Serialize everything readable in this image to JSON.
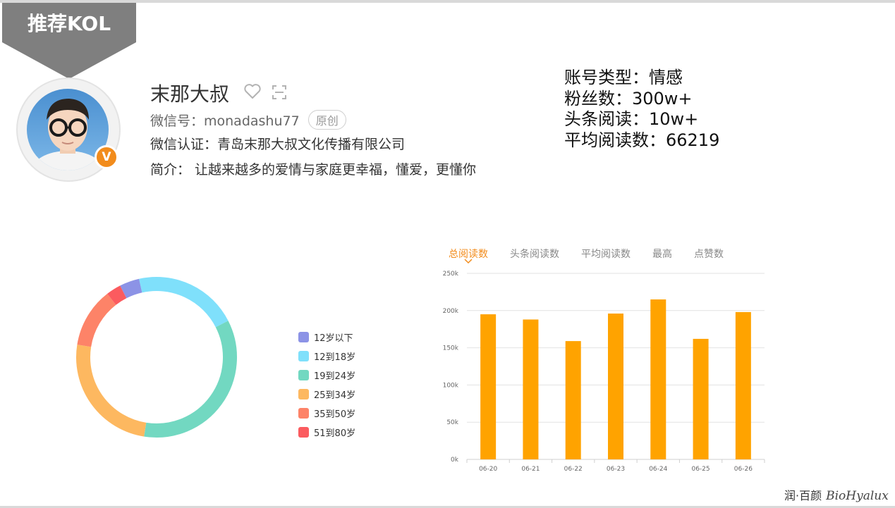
{
  "header": {
    "tag_label": "推荐KOL"
  },
  "profile": {
    "name": "末那大叔",
    "wechat_id": "微信号：monadashu77",
    "original_badge": "原创",
    "certification": "微信认证：青岛末那大叔文化传播有限公司",
    "intro": "简介： 让越来越多的爱情与家庭更幸福，懂爱，更懂你",
    "verified_badge": "V",
    "icons": [
      "heart-icon",
      "scan-icon"
    ]
  },
  "stats": {
    "account_type": "账号类型：情感",
    "followers": "粉丝数：300w+",
    "headline_reads": "头条阅读：10w+",
    "avg_reads": "平均阅读数：66219"
  },
  "age_chart": {
    "legend": [
      {
        "label": "12岁以下",
        "color": "#8c93e6"
      },
      {
        "label": "12到18岁",
        "color": "#7fe0fb"
      },
      {
        "label": "19到24岁",
        "color": "#72d8c1"
      },
      {
        "label": "25到34岁",
        "color": "#fdb860"
      },
      {
        "label": "35到50岁",
        "color": "#fd8368"
      },
      {
        "label": "51到80岁",
        "color": "#fb5b5f"
      }
    ]
  },
  "tabs": [
    "总阅读数",
    "头条阅读数",
    "平均阅读数",
    "最高",
    "点赞数"
  ],
  "active_tab": 0,
  "brand": {
    "name": "润·百颜",
    "latin": "BioHyalux"
  },
  "chart_data": [
    {
      "type": "pie",
      "donut": true,
      "categories": [
        "12岁以下",
        "12到18岁",
        "19到24岁",
        "25到34岁",
        "35到50岁",
        "51到80岁"
      ],
      "values": [
        4,
        21,
        35,
        25,
        12,
        3
      ],
      "colors": [
        "#8c93e6",
        "#7fe0fb",
        "#72d8c1",
        "#fdb860",
        "#fd8368",
        "#fb5b5f"
      ],
      "legend": "right"
    },
    {
      "type": "bar",
      "categories": [
        "06-20",
        "06-21",
        "06-22",
        "06-23",
        "06-24",
        "06-25",
        "06-26"
      ],
      "values": [
        195000,
        188000,
        159000,
        196000,
        215000,
        162000,
        198000
      ],
      "ylim": [
        0,
        250000
      ],
      "yticks": [
        "0k",
        "50k",
        "100k",
        "150k",
        "200k",
        "250k"
      ],
      "ytick_values": [
        0,
        50000,
        100000,
        150000,
        200000,
        250000
      ],
      "bar_color": "#ffa300",
      "grid": true
    }
  ]
}
